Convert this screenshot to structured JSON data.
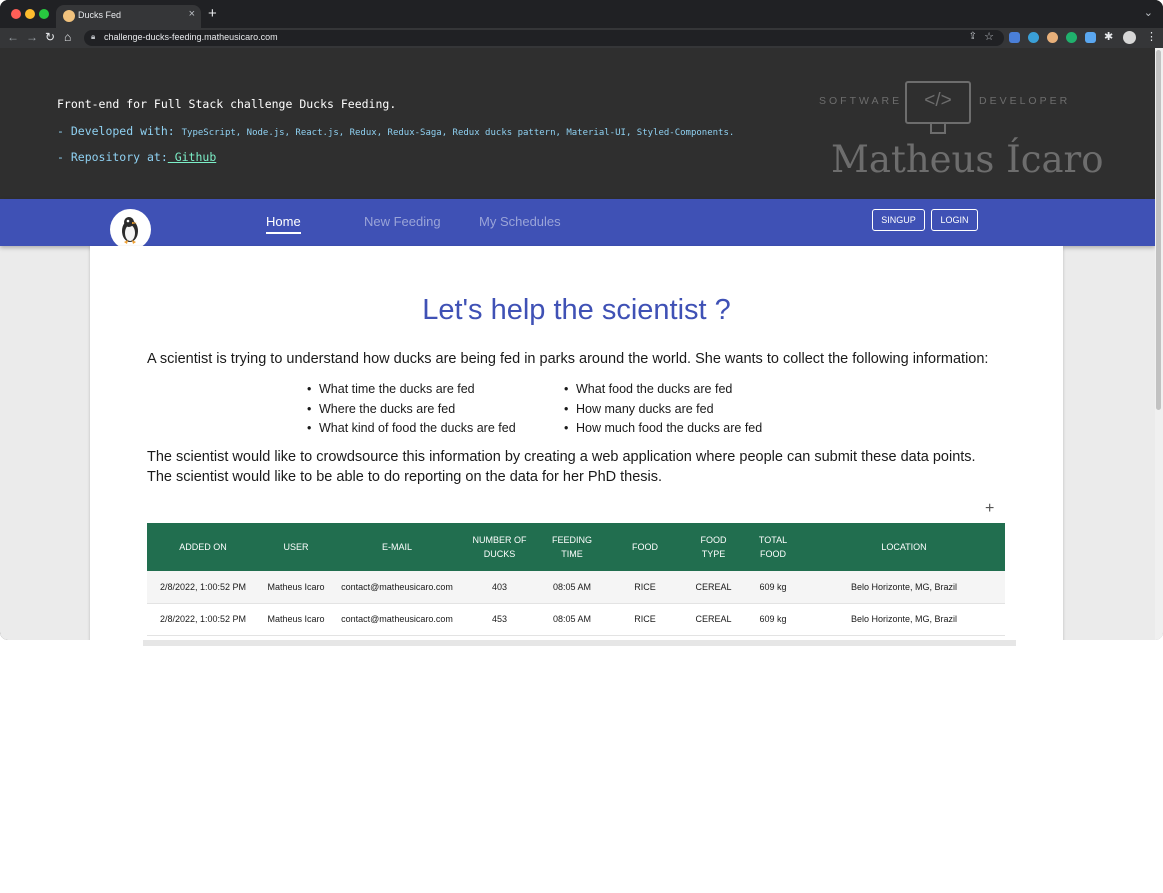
{
  "browser": {
    "tab_title": "Ducks Fed",
    "new_tab": "+",
    "tab_close": "×",
    "tab_menu": "⌄",
    "url": "challenge-ducks-feeding.matheusicaro.com"
  },
  "hero": {
    "title": "Front-end for Full Stack challenge Ducks Feeding.",
    "developed_label": "- Developed with: ",
    "developed_value": "TypeScript, Node.js, React.js, Redux, Redux-Saga, Redux ducks pattern, Material-UI, Styled-Components.",
    "repo_label": "- Repository at:",
    "repo_link": " Github",
    "logo": {
      "left_text": "SOFTWARE",
      "code_symbol": "</>",
      "right_text": "DEVELOPER",
      "name": "Matheus Ícaro"
    }
  },
  "nav": {
    "items": [
      {
        "label": "Home",
        "active": true
      },
      {
        "label": "New Feeding",
        "active": false
      },
      {
        "label": "My Schedules",
        "active": false
      }
    ],
    "signup": "SINGUP",
    "login": "LOGIN"
  },
  "main": {
    "headline": "Let's help the scientist ?",
    "intro": "A scientist is trying to understand how ducks are being fed in parks around the world. She wants to collect the following information:",
    "requirements_left": [
      "What time the ducks are fed",
      "Where the ducks are fed",
      "What kind of food the ducks are fed"
    ],
    "requirements_right": [
      "What food the ducks are fed",
      "How many ducks are fed",
      "How much food the ducks are fed"
    ],
    "closing_line1": "The scientist would like to crowdsource this information by creating a web application where people can submit these data points.",
    "closing_line2": "The scientist would like to be able to do reporting on the data for her PhD thesis.",
    "add_symbol": "+"
  },
  "table": {
    "headers": [
      [
        "ADDED ON"
      ],
      [
        "USER"
      ],
      [
        "E-MAIL"
      ],
      [
        "NUMBER OF",
        "DUCKS"
      ],
      [
        "FEEDING",
        "TIME"
      ],
      [
        "FOOD"
      ],
      [
        "FOOD",
        "TYPE"
      ],
      [
        "TOTAL",
        "FOOD"
      ],
      [
        "LOCATION"
      ]
    ],
    "rows": [
      [
        "2/8/2022, 1:00:52 PM",
        "Matheus Icaro",
        "contact@matheusicaro.com",
        "403",
        "08:05 AM",
        "RICE",
        "CEREAL",
        "609 kg",
        "Belo Horizonte, MG, Brazil"
      ],
      [
        "2/8/2022, 1:00:52 PM",
        "Matheus Icaro",
        "contact@matheusicaro.com",
        "453",
        "08:05 AM",
        "RICE",
        "CEREAL",
        "609 kg",
        "Belo Horizonte, MG, Brazil"
      ]
    ]
  },
  "colors": {
    "nav_bg": "#3f51b5",
    "hero_bg": "#2f2f2f",
    "table_header_bg": "#216e4f",
    "headline": "#3f51b5"
  }
}
